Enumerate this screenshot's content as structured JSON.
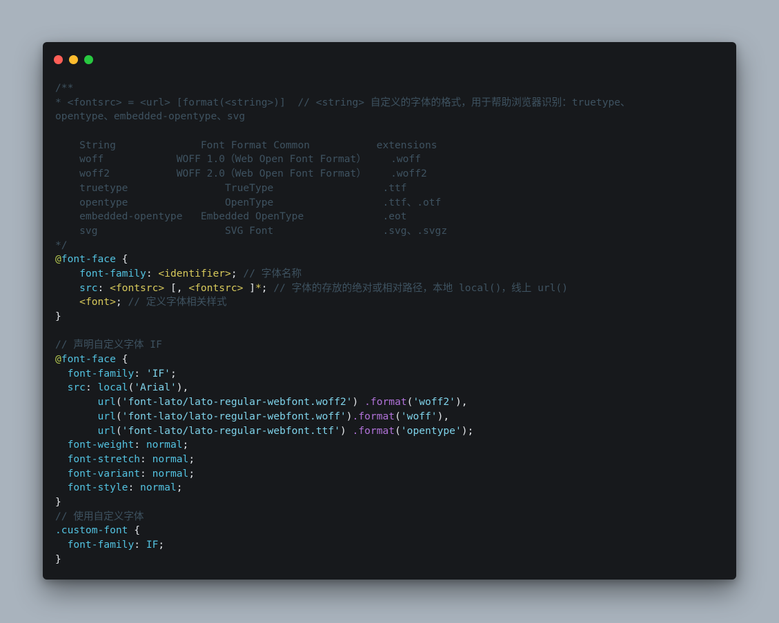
{
  "window": {
    "controls": {
      "close": "close",
      "minimize": "minimize",
      "zoom": "zoom"
    }
  },
  "code": {
    "l1": "/**",
    "l2": "* <fontsrc> = <url> [format(<string>)]  // <string> 自定义的字体的格式，用于帮助浏览器识别：truetype、",
    "l3": "opentype、embedded-opentype、svg",
    "l4": "",
    "l5": "    String              Font Format Common           extensions",
    "l6": "    woff            WOFF 1.0（Web Open Font Format）    .woff",
    "l7": "    woff2           WOFF 2.0（Web Open Font Format）    .woff2",
    "l8": "    truetype                TrueType                  .ttf",
    "l9": "    opentype                OpenType                  .ttf、.otf",
    "l10": "    embedded-opentype   Embedded OpenType             .eot",
    "l11": "    svg                     SVG Font                  .svg、.svgz",
    "l12": "*/",
    "ff1_at": "@",
    "ff1_kw": "font-face",
    "ff1_open": " {",
    "ff1_p1_indent": "    ",
    "ff1_p1_prop": "font-family",
    "ff1_p1_colon": ": ",
    "ff1_p1_val": "<identifier>",
    "ff1_p1_semi": "; ",
    "ff1_p1_cmt": "// 字体名称",
    "ff1_p2_indent": "    ",
    "ff1_p2_prop": "src",
    "ff1_p2_colon": ": ",
    "ff1_p2_v1": "<fontsrc>",
    "ff1_p2_mid": " [, ",
    "ff1_p2_v2": "<fontsrc>",
    "ff1_p2_end": " ]",
    "ff1_p2_star": "*",
    "ff1_p2_semi": "; ",
    "ff1_p2_cmt": "// 字体的存放的绝对或相对路径，本地 local()，线上 url()",
    "ff1_p3_indent": "    ",
    "ff1_p3_val": "<font>",
    "ff1_p3_semi": "; ",
    "ff1_p3_cmt": "// 定义字体相关样式",
    "ff1_close": "}",
    "c2": "// 声明自定义字体 IF",
    "ff2_at": "@",
    "ff2_kw": "font-face",
    "ff2_open": " {",
    "ff2_p1_indent": "  ",
    "ff2_p1_prop": "font-family",
    "ff2_p1_colon": ": ",
    "ff2_p1_val": "'IF'",
    "ff2_p1_semi": ";",
    "ff2_p2_indent": "  ",
    "ff2_p2_prop": "src",
    "ff2_p2_colon": ": ",
    "ff2_p2_fn": "local",
    "ff2_p2_lp": "(",
    "ff2_p2_val": "'Arial'",
    "ff2_p2_rp": "),",
    "u1_indent": "       ",
    "u1_fn": "url",
    "u1_lp": "(",
    "u1_val": "'font-lato/lato-regular-webfont.woff2'",
    "u1_rp": ") ",
    "u1_dot": ".",
    "u1_fmt": "format",
    "u1_flp": "(",
    "u1_fval": "'woff2'",
    "u1_frp": "),",
    "u2_indent": "       ",
    "u2_fn": "url",
    "u2_lp": "(",
    "u2_val": "'font-lato/lato-regular-webfont.woff'",
    "u2_rp": ")",
    "u2_dot": ".",
    "u2_fmt": "format",
    "u2_flp": "(",
    "u2_fval": "'woff'",
    "u2_frp": "),",
    "u3_indent": "       ",
    "u3_fn": "url",
    "u3_lp": "(",
    "u3_val": "'font-lato/lato-regular-webfont.ttf'",
    "u3_rp": ") ",
    "u3_dot": ".",
    "u3_fmt": "format",
    "u3_flp": "(",
    "u3_fval": "'opentype'",
    "u3_frp": ");",
    "ff2_p3_indent": "  ",
    "ff2_p3_prop": "font-weight",
    "ff2_p3_colon": ": ",
    "ff2_p3_val": "normal",
    "ff2_p3_semi": ";",
    "ff2_p4_indent": "  ",
    "ff2_p4_prop": "font-stretch",
    "ff2_p4_colon": ": ",
    "ff2_p4_val": "normal",
    "ff2_p4_semi": ";",
    "ff2_p5_indent": "  ",
    "ff2_p5_prop": "font-variant",
    "ff2_p5_colon": ": ",
    "ff2_p5_val": "normal",
    "ff2_p5_semi": ";",
    "ff2_p6_indent": "  ",
    "ff2_p6_prop": "font-style",
    "ff2_p6_colon": ": ",
    "ff2_p6_val": "normal",
    "ff2_p6_semi": ";",
    "ff2_close": "}",
    "c3": "// 使用自定义字体",
    "cf_sel": ".custom-font",
    "cf_open": " {",
    "cf_p1_indent": "  ",
    "cf_p1_prop": "font-family",
    "cf_p1_colon": ": ",
    "cf_p1_val": "IF",
    "cf_p1_semi": ";",
    "cf_close": "}"
  }
}
